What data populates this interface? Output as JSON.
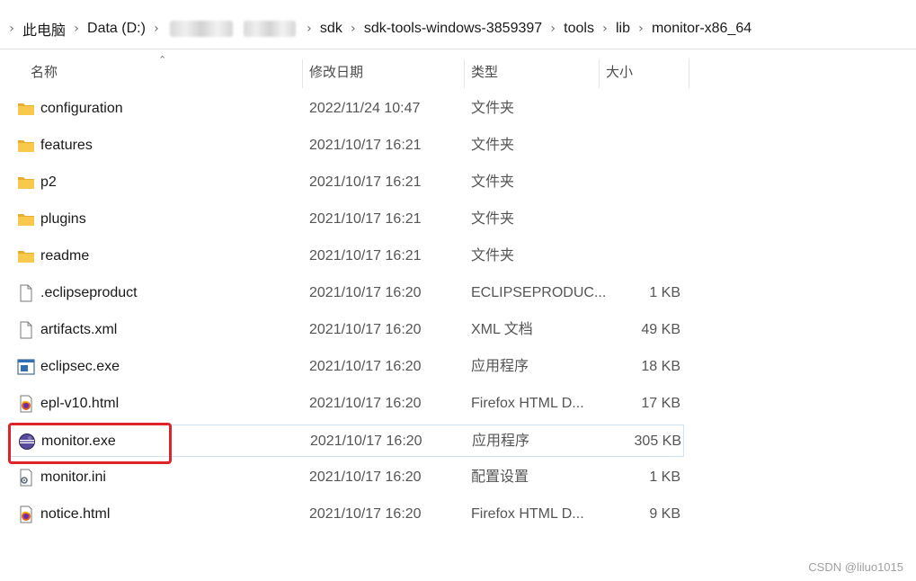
{
  "breadcrumb": {
    "this_pc": "此电脑",
    "drive": "Data (D:)",
    "sdk": "sdk",
    "tools_win": "sdk-tools-windows-3859397",
    "tools": "tools",
    "lib": "lib",
    "current": "monitor-x86_64"
  },
  "columns": {
    "name": "名称",
    "date": "修改日期",
    "type": "类型",
    "size": "大小"
  },
  "files": [
    {
      "name": "configuration",
      "date": "2022/11/24 10:47",
      "type": "文件夹",
      "size": "",
      "icon": "folder-icon"
    },
    {
      "name": "features",
      "date": "2021/10/17 16:21",
      "type": "文件夹",
      "size": "",
      "icon": "folder-icon"
    },
    {
      "name": "p2",
      "date": "2021/10/17 16:21",
      "type": "文件夹",
      "size": "",
      "icon": "folder-icon"
    },
    {
      "name": "plugins",
      "date": "2021/10/17 16:21",
      "type": "文件夹",
      "size": "",
      "icon": "folder-icon"
    },
    {
      "name": "readme",
      "date": "2021/10/17 16:21",
      "type": "文件夹",
      "size": "",
      "icon": "folder-icon"
    },
    {
      "name": ".eclipseproduct",
      "date": "2021/10/17 16:20",
      "type": "ECLIPSEPRODUC...",
      "size": "1 KB",
      "icon": "document-icon"
    },
    {
      "name": "artifacts.xml",
      "date": "2021/10/17 16:20",
      "type": "XML 文档",
      "size": "49 KB",
      "icon": "document-icon"
    },
    {
      "name": "eclipsec.exe",
      "date": "2021/10/17 16:20",
      "type": "应用程序",
      "size": "18 KB",
      "icon": "console-app-icon"
    },
    {
      "name": "epl-v10.html",
      "date": "2021/10/17 16:20",
      "type": "Firefox HTML D...",
      "size": "17 KB",
      "icon": "firefox-html-icon"
    },
    {
      "name": "monitor.exe",
      "date": "2021/10/17 16:20",
      "type": "应用程序",
      "size": "305 KB",
      "icon": "eclipse-icon"
    },
    {
      "name": "monitor.ini",
      "date": "2021/10/17 16:20",
      "type": "配置设置",
      "size": "1 KB",
      "icon": "settings-file-icon"
    },
    {
      "name": "notice.html",
      "date": "2021/10/17 16:20",
      "type": "Firefox HTML D...",
      "size": "9 KB",
      "icon": "firefox-html-icon"
    }
  ],
  "selected_file": "monitor.exe",
  "watermark": "CSDN @liluo1015",
  "colors": {
    "folder": "#f5c34c",
    "highlight": "#e0232b",
    "selection_border": "#cfe3f3"
  }
}
